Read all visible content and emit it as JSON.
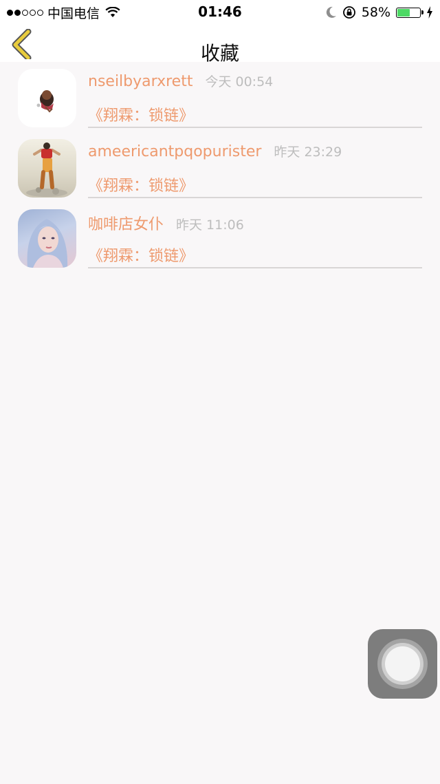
{
  "status_bar": {
    "carrier": "中国电信",
    "time": "01:46",
    "battery_percent": "58%",
    "battery_level": 0.58,
    "icons": [
      "signal-dots-icon",
      "wifi-icon",
      "moon-icon",
      "rotation-lock-icon",
      "battery-icon",
      "charging-icon"
    ]
  },
  "nav": {
    "back_icon": "chevron-left-icon",
    "title": "收藏"
  },
  "items": [
    {
      "username": "nseilbyarxrett",
      "time": "今天 00:54",
      "work": "《翔霖：锁链》"
    },
    {
      "username": "ameericantpqopurister",
      "time": "昨天 23:29",
      "work": "《翔霖：锁链》"
    },
    {
      "username": "咖啡店女仆",
      "time": "昨天 11:06",
      "work": "《翔霖：锁链》"
    }
  ],
  "colors": {
    "accent": "#ee9a6e",
    "time_gray": "#bdbdbd",
    "back_arrow": "#e8cc3d",
    "battery_green": "#4cd964",
    "background": "#f9f7f8"
  }
}
